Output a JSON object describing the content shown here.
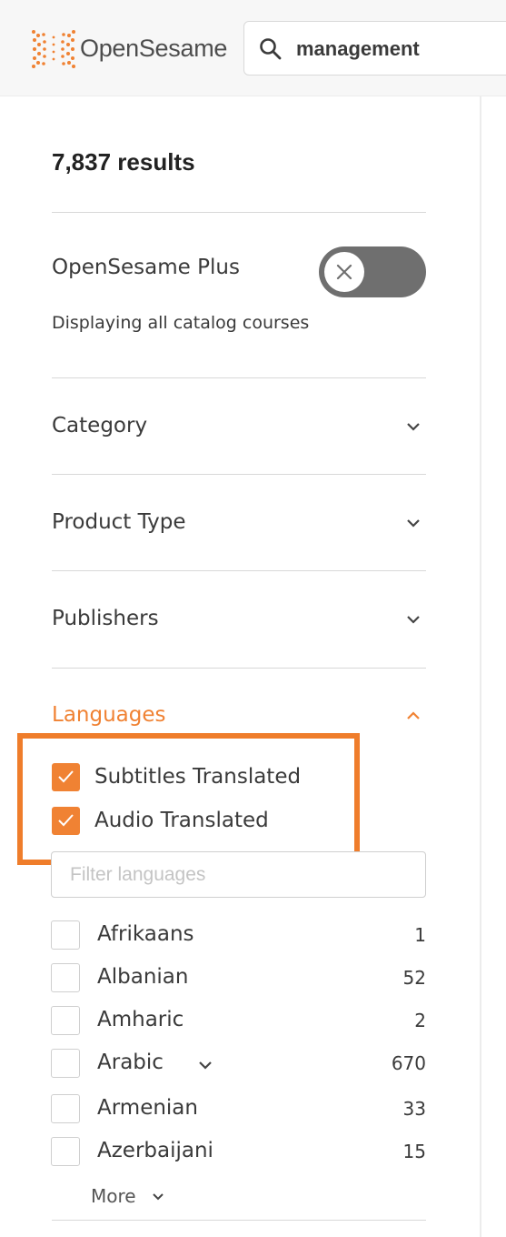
{
  "header": {
    "logo_text": "OpenSesame",
    "search_query": "management",
    "search_icon": "search-icon"
  },
  "sidebar": {
    "results_count": "7,837 results",
    "plus": {
      "label": "OpenSesame Plus",
      "toggle_state": "off",
      "description": "Displaying all catalog courses"
    },
    "facets": [
      {
        "label": "Category",
        "expanded": false
      },
      {
        "label": "Product Type",
        "expanded": false
      },
      {
        "label": "Publishers",
        "expanded": false
      },
      {
        "label": "Languages",
        "expanded": true
      }
    ],
    "language_options": [
      {
        "label": "Subtitles Translated",
        "checked": true
      },
      {
        "label": "Audio Translated",
        "checked": true
      }
    ],
    "filter_placeholder": "Filter languages",
    "languages": [
      {
        "name": "Afrikaans",
        "count": "1"
      },
      {
        "name": "Albanian",
        "count": "52"
      },
      {
        "name": "Amharic",
        "count": "2"
      },
      {
        "name": "Arabic",
        "count": "670",
        "has_sub": true
      },
      {
        "name": "Armenian",
        "count": "33"
      },
      {
        "name": "Azerbaijani",
        "count": "15"
      }
    ],
    "more_label": "More"
  },
  "colors": {
    "accent": "#f08233",
    "highlight_box": "#ef7d2b",
    "toggle_off": "#6f6f6f"
  }
}
